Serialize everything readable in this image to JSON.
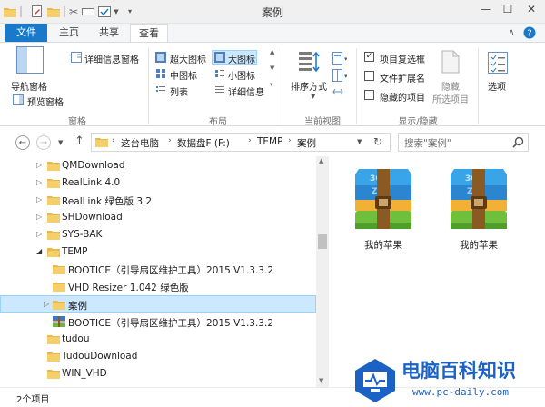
{
  "window": {
    "title": "案例"
  },
  "ribbon_tabs": [
    "文件",
    "主页",
    "共享",
    "查看"
  ],
  "ribbon": {
    "panes": {
      "nav_pane": "导航窗格",
      "preview_pane": "预览窗格",
      "details_pane": "详细信息窗格",
      "group": "窗格"
    },
    "layout": {
      "extra_large_icons": "超大图标",
      "large_icons": "大图标",
      "medium_icons": "中图标",
      "small_icons": "小图标",
      "list": "列表",
      "details": "详细信息",
      "group": "布局"
    },
    "current_view": {
      "sort_by": "排序方式",
      "group": "当前视图"
    },
    "show_hide": {
      "item_checkboxes": "项目复选框",
      "item_checkboxes_checked": true,
      "file_extensions": "文件扩展名",
      "file_extensions_checked": false,
      "hidden_items": "隐藏的项目",
      "hidden_items_checked": false,
      "hide_selected": "隐藏",
      "hide_selected_2": "所选项目",
      "group": "显示/隐藏"
    },
    "options": "选项"
  },
  "address": {
    "crumbs": [
      "这台电脑",
      "数据盘F (F:)",
      "TEMP",
      "案例"
    ],
    "search_placeholder": "搜索\"案例\""
  },
  "tree": [
    {
      "label": "QMDownload",
      "expander": "collapsed"
    },
    {
      "label": "RealLink 4.0",
      "expander": "collapsed"
    },
    {
      "label": "RealLink 绿色版 3.2",
      "expander": "collapsed"
    },
    {
      "label": "SHDownload",
      "expander": "collapsed"
    },
    {
      "label": "SYS-BAK",
      "expander": "collapsed"
    },
    {
      "label": "TEMP",
      "expander": "expanded"
    },
    {
      "label": "BOOTICE（引导扇区维护工具）2015 V1.3.3.2",
      "expander": "none"
    },
    {
      "label": "VHD Resizer 1.042 绿色版",
      "expander": "none"
    },
    {
      "label": "案例",
      "expander": "collapsed",
      "selected": true
    },
    {
      "label": "BOOTICE（引导扇区维护工具）2015 V1.3.3.2",
      "expander": "none",
      "icon": "archive"
    },
    {
      "label": "tudou",
      "expander": "none"
    },
    {
      "label": "TudouDownload",
      "expander": "none"
    },
    {
      "label": "WIN_VHD",
      "expander": "none"
    }
  ],
  "files": [
    {
      "name": "我的苹果",
      "icon": "zip-archive-icon"
    },
    {
      "name": "我的苹果",
      "icon": "zip-archive-icon"
    }
  ],
  "status": {
    "count_text": "2个项目"
  },
  "watermark": {
    "title": "电脑百科知识",
    "url": "www.pc-daily.com"
  },
  "colors": {
    "accent": "#1979ca",
    "selection": "#cce8ff",
    "folder": "#e8b84a"
  }
}
